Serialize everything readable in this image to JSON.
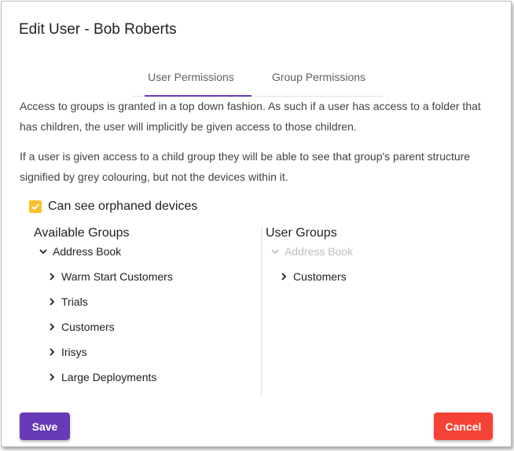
{
  "dialog": {
    "title": "Edit User - Bob Roberts"
  },
  "tabs": [
    {
      "label": "User Permissions",
      "active": true
    },
    {
      "label": "Group Permissions",
      "active": false
    }
  ],
  "description": {
    "para1": "Access to groups is granted in a top down fashion. As such if a user has access to a folder that has children, the user will implicitly be given access to those children.",
    "para2": "If a user is given access to a child group they will be able to see that group's parent structure signified by grey colouring, but not the devices within it."
  },
  "orphaned": {
    "label": "Can see orphaned devices",
    "checked": true
  },
  "available_groups": {
    "heading": "Available Groups",
    "root": {
      "label": "Address Book",
      "expanded": true,
      "icon": "chevron-down-icon"
    },
    "children": [
      {
        "label": "Warm Start Customers",
        "icon": "chevron-right-icon"
      },
      {
        "label": "Trials",
        "icon": "chevron-right-icon"
      },
      {
        "label": "Customers",
        "icon": "chevron-right-icon"
      },
      {
        "label": "Irisys",
        "icon": "chevron-right-icon"
      },
      {
        "label": "Large Deployments",
        "icon": "chevron-right-icon"
      }
    ]
  },
  "user_groups": {
    "heading": "User Groups",
    "root": {
      "label": "Address Book",
      "expanded": true,
      "disabled": true,
      "icon": "chevron-down-icon"
    },
    "children": [
      {
        "label": "Customers",
        "icon": "chevron-right-icon"
      }
    ]
  },
  "buttons": {
    "save": "Save",
    "cancel": "Cancel"
  },
  "colors": {
    "accent": "#673ab7",
    "checkbox": "#fbc02d",
    "cancel": "#f44336",
    "disabled_text": "#bdbdbd"
  }
}
